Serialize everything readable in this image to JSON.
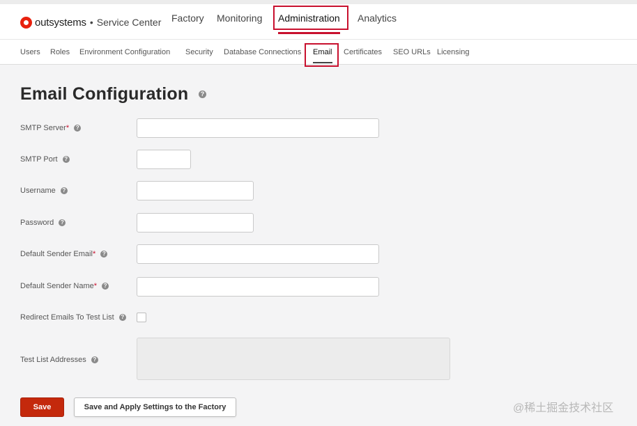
{
  "brand": {
    "name": "outsystems",
    "separator": "•",
    "product": "Service Center",
    "color": "#e8210e"
  },
  "main_nav": {
    "items": [
      {
        "label": "Factory"
      },
      {
        "label": "Monitoring"
      },
      {
        "label": "Administration",
        "active": true
      },
      {
        "label": "Analytics"
      }
    ]
  },
  "sub_nav": {
    "items": [
      {
        "label": "Users"
      },
      {
        "label": "Roles"
      },
      {
        "label": "Environment Configuration"
      },
      {
        "label": "Security"
      },
      {
        "label": "Database Connections"
      },
      {
        "label": "Email",
        "active": true
      },
      {
        "label": "Certificates"
      },
      {
        "label": "SEO URLs"
      },
      {
        "label": "Licensing"
      }
    ]
  },
  "page": {
    "title": "Email Configuration",
    "help_glyph": "?"
  },
  "form": {
    "smtp_server": {
      "label": "SMTP Server",
      "required": "*",
      "value": ""
    },
    "smtp_port": {
      "label": "SMTP Port",
      "value": ""
    },
    "username": {
      "label": "Username",
      "value": ""
    },
    "password": {
      "label": "Password",
      "value": ""
    },
    "default_sender_email": {
      "label": "Default Sender Email",
      "required": "*",
      "value": ""
    },
    "default_sender_name": {
      "label": "Default Sender Name",
      "required": "*",
      "value": ""
    },
    "redirect_emails": {
      "label": "Redirect Emails To Test List",
      "checked": false
    },
    "test_list_addresses": {
      "label": "Test List Addresses",
      "value": ""
    }
  },
  "actions": {
    "save_label": "Save",
    "apply_label": "Save and Apply Settings to the Factory"
  },
  "watermark": "@稀土掘金技术社区",
  "colors": {
    "accent": "#c8102e",
    "save_button": "#c4290c",
    "background": "#f4f4f5"
  }
}
